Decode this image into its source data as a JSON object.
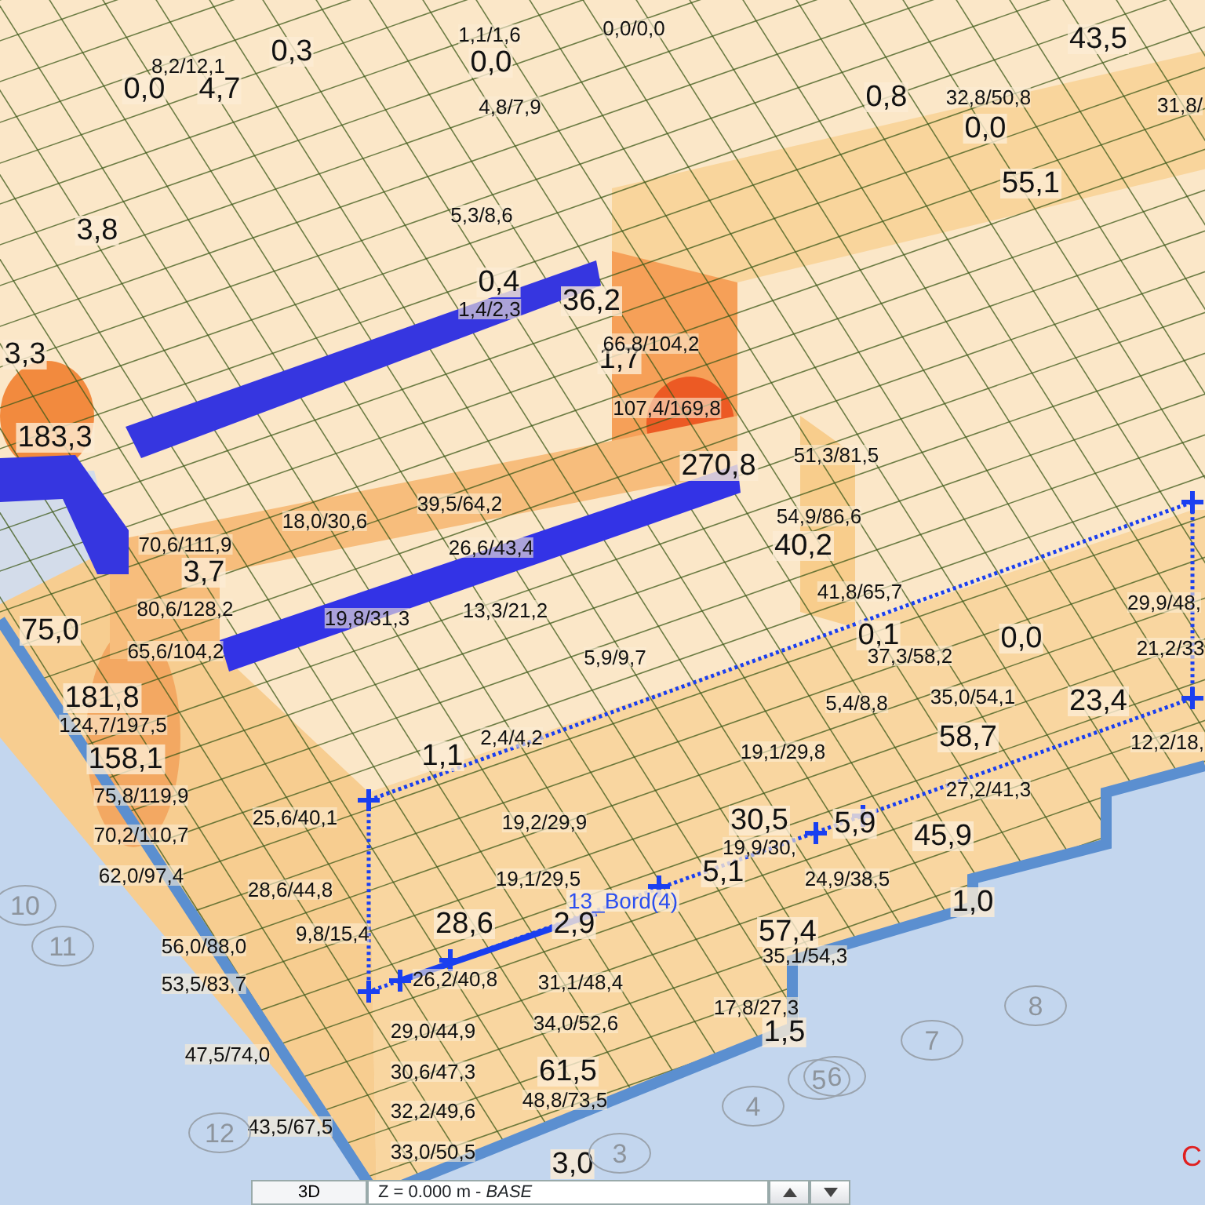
{
  "viewport": {
    "labels": [
      {
        "text": "0,3",
        "kind": "value"
      },
      {
        "text": "0,0",
        "kind": "value"
      },
      {
        "text": "0,0",
        "kind": "value"
      },
      {
        "text": "4,7",
        "kind": "value"
      },
      {
        "text": "43,5",
        "kind": "value"
      },
      {
        "text": "0,8",
        "kind": "value"
      },
      {
        "text": "0,0",
        "kind": "value"
      },
      {
        "text": "55,1",
        "kind": "value"
      },
      {
        "text": "3,8",
        "kind": "value"
      },
      {
        "text": "0,4",
        "kind": "value"
      },
      {
        "text": "36,2",
        "kind": "value"
      },
      {
        "text": "3,3",
        "kind": "value"
      },
      {
        "text": "1,7",
        "kind": "value"
      },
      {
        "text": "183,3",
        "kind": "value"
      },
      {
        "text": "270,8",
        "kind": "value"
      },
      {
        "text": "40,2",
        "kind": "value"
      },
      {
        "text": "3,7",
        "kind": "value"
      },
      {
        "text": "75,0",
        "kind": "value"
      },
      {
        "text": "0,1",
        "kind": "value"
      },
      {
        "text": "0,0",
        "kind": "value"
      },
      {
        "text": "181,8",
        "kind": "value"
      },
      {
        "text": "23,4",
        "kind": "value"
      },
      {
        "text": "58,7",
        "kind": "value"
      },
      {
        "text": "158,1",
        "kind": "value"
      },
      {
        "text": "1,1",
        "kind": "value"
      },
      {
        "text": "30,5",
        "kind": "value"
      },
      {
        "text": "5,9",
        "kind": "value"
      },
      {
        "text": "45,9",
        "kind": "value"
      },
      {
        "text": "5,1",
        "kind": "value"
      },
      {
        "text": "28,6",
        "kind": "value"
      },
      {
        "text": "2,9",
        "kind": "value"
      },
      {
        "text": "57,4",
        "kind": "value"
      },
      {
        "text": "1,0",
        "kind": "value"
      },
      {
        "text": "1,5",
        "kind": "value"
      },
      {
        "text": "61,5",
        "kind": "value"
      },
      {
        "text": "3,0",
        "kind": "value"
      },
      {
        "text": "8,2/12,1",
        "kind": "range"
      },
      {
        "text": "1,1/1,6",
        "kind": "range"
      },
      {
        "text": "0,0/0,0",
        "kind": "range"
      },
      {
        "text": "4,8/7,9",
        "kind": "range"
      },
      {
        "text": "32,8/50,8",
        "kind": "range"
      },
      {
        "text": "31,8/",
        "kind": "range"
      },
      {
        "text": "5,3/8,6",
        "kind": "range"
      },
      {
        "text": "1,4/2,3",
        "kind": "range"
      },
      {
        "text": "66,8/104,2",
        "kind": "range"
      },
      {
        "text": "107,4/169,8",
        "kind": "range"
      },
      {
        "text": "51,3/81,5",
        "kind": "range"
      },
      {
        "text": "18,0/30,6",
        "kind": "range"
      },
      {
        "text": "39,5/64,2",
        "kind": "range"
      },
      {
        "text": "70,6/111,9",
        "kind": "range"
      },
      {
        "text": "26,6/43,4",
        "kind": "range"
      },
      {
        "text": "54,9/86,6",
        "kind": "range"
      },
      {
        "text": "80,6/128,2",
        "kind": "range"
      },
      {
        "text": "13,3/21,2",
        "kind": "range"
      },
      {
        "text": "19,8/31,3",
        "kind": "range"
      },
      {
        "text": "41,8/65,7",
        "kind": "range"
      },
      {
        "text": "29,9/48,",
        "kind": "range"
      },
      {
        "text": "65,6/104,2",
        "kind": "range"
      },
      {
        "text": "5,9/9,7",
        "kind": "range"
      },
      {
        "text": "37,3/58,2",
        "kind": "range"
      },
      {
        "text": "21,2/33",
        "kind": "range"
      },
      {
        "text": "5,4/8,8",
        "kind": "range"
      },
      {
        "text": "35,0/54,1",
        "kind": "range"
      },
      {
        "text": "124,7/197,5",
        "kind": "range"
      },
      {
        "text": "2,4/4,2",
        "kind": "range"
      },
      {
        "text": "19,1/29,8",
        "kind": "range"
      },
      {
        "text": "12,2/18,",
        "kind": "range"
      },
      {
        "text": "27,2/41,3",
        "kind": "range"
      },
      {
        "text": "75,8/119,9",
        "kind": "range"
      },
      {
        "text": "25,6/40,1",
        "kind": "range"
      },
      {
        "text": "19,2/29,9",
        "kind": "range"
      },
      {
        "text": "70,2/110,7",
        "kind": "range"
      },
      {
        "text": "19,9/30,",
        "kind": "range"
      },
      {
        "text": "62,0/97,4",
        "kind": "range"
      },
      {
        "text": "28,6/44,8",
        "kind": "range"
      },
      {
        "text": "19,1/29,5",
        "kind": "range"
      },
      {
        "text": "24,9/38,5",
        "kind": "range"
      },
      {
        "text": "9,8/15,4",
        "kind": "range"
      },
      {
        "text": "56,0/88,0",
        "kind": "range"
      },
      {
        "text": "35,1/54,3",
        "kind": "range"
      },
      {
        "text": "53,5/83,7",
        "kind": "range"
      },
      {
        "text": "26,2/40,8",
        "kind": "range"
      },
      {
        "text": "31,1/48,4",
        "kind": "range"
      },
      {
        "text": "17,8/27,3",
        "kind": "range"
      },
      {
        "text": "29,0/44,9",
        "kind": "range"
      },
      {
        "text": "34,0/52,6",
        "kind": "range"
      },
      {
        "text": "47,5/74,0",
        "kind": "range"
      },
      {
        "text": "30,6/47,3",
        "kind": "range"
      },
      {
        "text": "48,8/73,5",
        "kind": "range"
      },
      {
        "text": "32,2/49,6",
        "kind": "range"
      },
      {
        "text": "43,5/67,5",
        "kind": "range"
      },
      {
        "text": "33,0/50,5",
        "kind": "range"
      }
    ],
    "selection_label": {
      "text": "13_Bord(4)"
    },
    "grid_axes": [
      {
        "text": "10"
      },
      {
        "text": "11"
      },
      {
        "text": "12"
      },
      {
        "text": "3"
      },
      {
        "text": "4"
      },
      {
        "text": "5"
      },
      {
        "text": "6"
      },
      {
        "text": "7"
      },
      {
        "text": "8"
      }
    ],
    "corner_mark": {
      "text": "C"
    }
  },
  "toolbar": {
    "view_tab": {
      "label": "3D",
      "selected": true
    },
    "level_field": {
      "value": "Z = 0.000 m - *BASE*"
    }
  }
}
